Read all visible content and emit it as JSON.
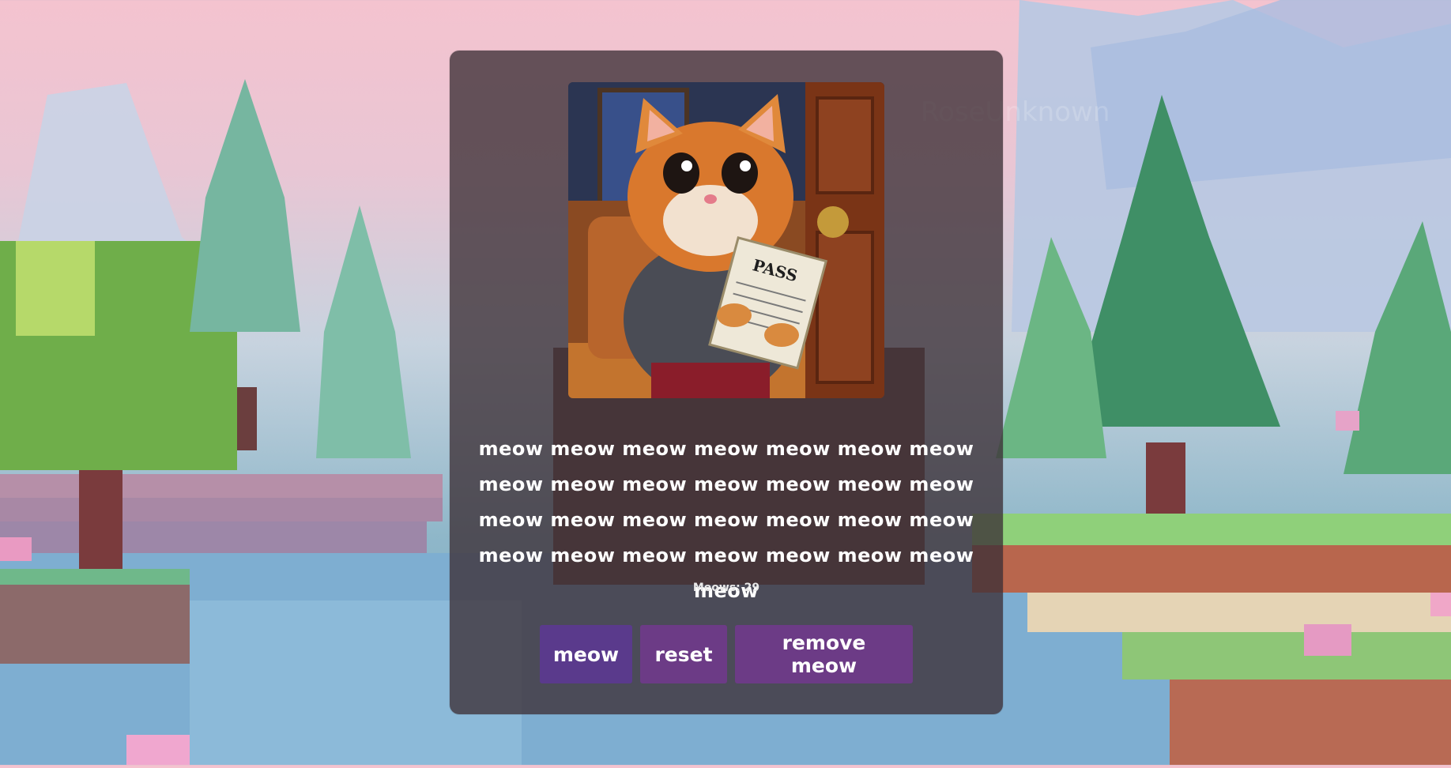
{
  "meow_text": "meow meow meow meow meow meow meow meow meow meow meow meow meow meow meow meow meow meow meow meow meow meow meow meow meow meow meow meow meow",
  "counter_text": "Meows: 29",
  "buttons": {
    "meow": "meow",
    "reset": "reset",
    "remove": "remove meow"
  },
  "watermark": "RoseUnknown",
  "image": {
    "pass_text": "PASS"
  },
  "colors": {
    "card": "#3c3036",
    "meow_button": "#5a3a8c",
    "other_buttons": "#6c3b86"
  }
}
